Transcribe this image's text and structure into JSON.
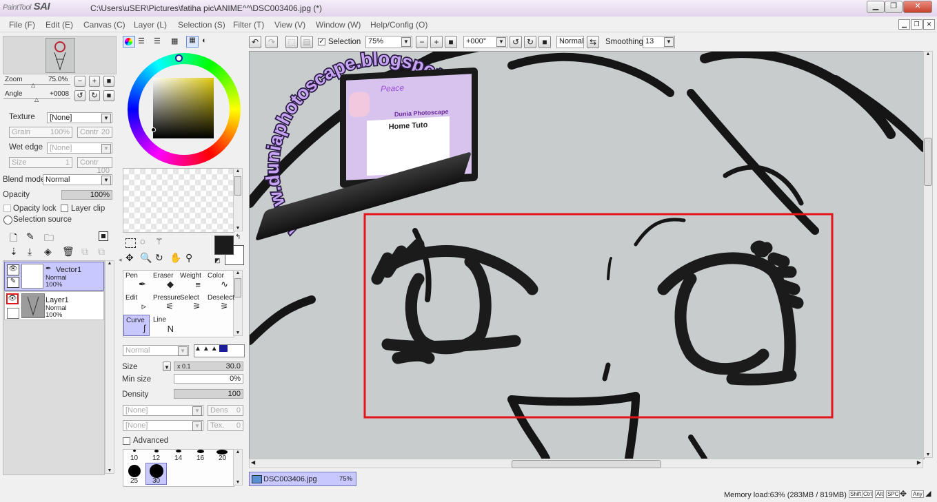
{
  "window": {
    "app_name": "SAI",
    "app_prefix": "PaintTool",
    "title": "C:\\Users\\uSER\\Pictures\\fatiha pic\\ANIME^^\\DSC003406.jpg (*)"
  },
  "menu": [
    "File (F)",
    "Edit (E)",
    "Canvas (C)",
    "Layer (L)",
    "Selection (S)",
    "Filter (T)",
    "View (V)",
    "Window (W)",
    "Help/Config (O)"
  ],
  "navigator": {
    "zoom_label": "Zoom",
    "zoom_value": "75.0%",
    "angle_label": "Angle",
    "angle_value": "+0008"
  },
  "texture": {
    "label": "Texture",
    "value": "[None]",
    "grain_label": "Grain",
    "grain_value": "100%",
    "contr_label": "Contr",
    "contr_value": "20"
  },
  "wet_edge": {
    "label": "Wet edge",
    "value": "[None]",
    "size_label": "Size",
    "size_value": "1",
    "contr_label": "Contr",
    "contr_value": "100"
  },
  "blend": {
    "label": "Blend mode",
    "value": "Normal"
  },
  "opacity": {
    "label": "Opacity",
    "value": "100%"
  },
  "checks": {
    "opacity_lock": "Opacity lock",
    "layer_clip": "Layer clip",
    "selection_source": "Selection source"
  },
  "layers": [
    {
      "name": "Vector1",
      "mode": "Normal",
      "opacity": "100%"
    },
    {
      "name": "Layer1",
      "mode": "Normal",
      "opacity": "100%"
    }
  ],
  "tools": [
    {
      "label": "Pen",
      "icon": "✒"
    },
    {
      "label": "Eraser",
      "icon": "◆"
    },
    {
      "label": "Weight",
      "icon": "≡"
    },
    {
      "label": "Color",
      "icon": "∿"
    },
    {
      "label": "Edit",
      "icon": "▹"
    },
    {
      "label": "Pressure",
      "icon": "⚟"
    },
    {
      "label": "Select",
      "icon": "⚞"
    },
    {
      "label": "Deselect",
      "icon": "⚞"
    },
    {
      "label": "Curve",
      "icon": "ʃ"
    },
    {
      "label": "Line",
      "icon": "N"
    }
  ],
  "brush": {
    "mode": "Normal",
    "size_label": "Size",
    "size_mult": "x 0.1",
    "size_value": "30.0",
    "min_size_label": "Min size",
    "min_size_value": "0%",
    "density_label": "Density",
    "density_value": "100",
    "tex1": "[None]",
    "tex2": "[None]",
    "dens_label": "Dens",
    "dens_value": "0",
    "tex_label": "Tex.",
    "tex_value": "0",
    "advanced_label": "Advanced",
    "sizes": [
      "10",
      "12",
      "14",
      "16",
      "20",
      "25",
      "30"
    ]
  },
  "toolbar": {
    "selection_label": "Selection",
    "zoom_value": "75%",
    "angle_value": "+000°",
    "mode_value": "Normal",
    "smoothing_label": "Smoothing",
    "smoothing_value": "13"
  },
  "overlay": {
    "arc_text": "www.duniaphotoscape.blogspot.com",
    "laptop_title": "Peace",
    "laptop_subtitle": "Dunia Photoscape",
    "laptop_heading": "Home Tuto"
  },
  "document_tab": {
    "name": "DSC003406.jpg",
    "zoom": "75%"
  },
  "status": {
    "memory": "Memory load:63% (283MB / 819MB)",
    "keys": [
      "Shift",
      "Ctrl",
      "Alt",
      "SPC",
      "Any"
    ]
  },
  "colors": {
    "selection_rect": "#e4141b",
    "accent": "#c8c8ff",
    "primary_color": "#1b1b1b",
    "canvas_bg": "#c8cccc"
  }
}
